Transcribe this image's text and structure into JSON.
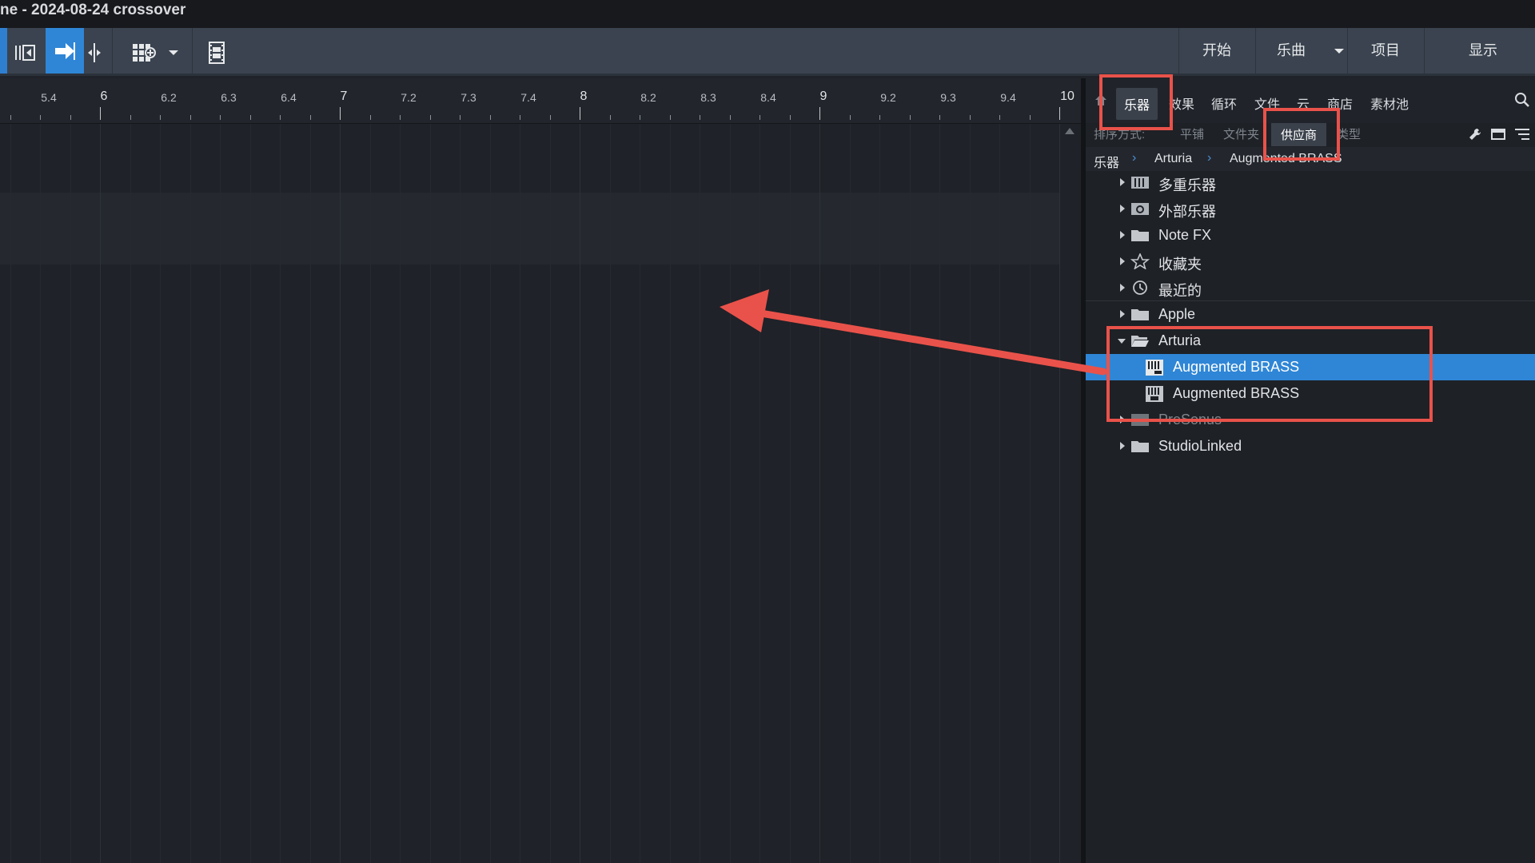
{
  "window": {
    "title": "ne - 2024-08-24 crossover"
  },
  "toolbar": {
    "nav": [
      "开始",
      "乐曲",
      "项目",
      "显示"
    ],
    "icons": [
      "timeline-start-icon",
      "arrow-tool-icon",
      "split-tool-icon",
      "grid-add-icon",
      "dropdown-icon",
      "film-icon"
    ]
  },
  "ruler": {
    "labels": [
      "5.4",
      "6",
      "6.2",
      "6.3",
      "6.4",
      "7",
      "7.2",
      "7.3",
      "7.4",
      "8",
      "8.2",
      "8.3",
      "8.4",
      "9",
      "9.2",
      "9.3",
      "9.4",
      "10"
    ]
  },
  "browser": {
    "tabs": [
      "乐器",
      "效果",
      "循环",
      "文件",
      "云",
      "商店",
      "素材池"
    ],
    "active_tab": "乐器",
    "sort": {
      "label": "排序方式:",
      "options": [
        "平铺",
        "文件夹",
        "供应商",
        "类型"
      ],
      "active": "供应商"
    },
    "breadcrumb": [
      "乐器",
      "Arturia",
      "Augmented BRASS"
    ],
    "items": [
      {
        "label": "多重乐器",
        "icon": "multi-instrument-icon"
      },
      {
        "label": "外部乐器",
        "icon": "external-instrument-icon"
      },
      {
        "label": "Note FX",
        "icon": "folder-icon"
      },
      {
        "label": "收藏夹",
        "icon": "star-icon"
      },
      {
        "label": "最近的",
        "icon": "clock-icon"
      },
      {
        "label": "Apple",
        "icon": "folder-icon"
      },
      {
        "label": "Arturia",
        "icon": "folder-open-icon",
        "expanded": true
      },
      {
        "label": "Augmented BRASS",
        "icon": "vst-plugin-icon",
        "selected": true
      },
      {
        "label": "Augmented BRASS",
        "icon": "au-plugin-icon"
      },
      {
        "label": "PreSonus",
        "icon": "presonus-icon"
      },
      {
        "label": "StudioLinked",
        "icon": "folder-icon"
      }
    ]
  },
  "colors": {
    "accent": "#2f86d6",
    "highlight": "#e9524a"
  }
}
